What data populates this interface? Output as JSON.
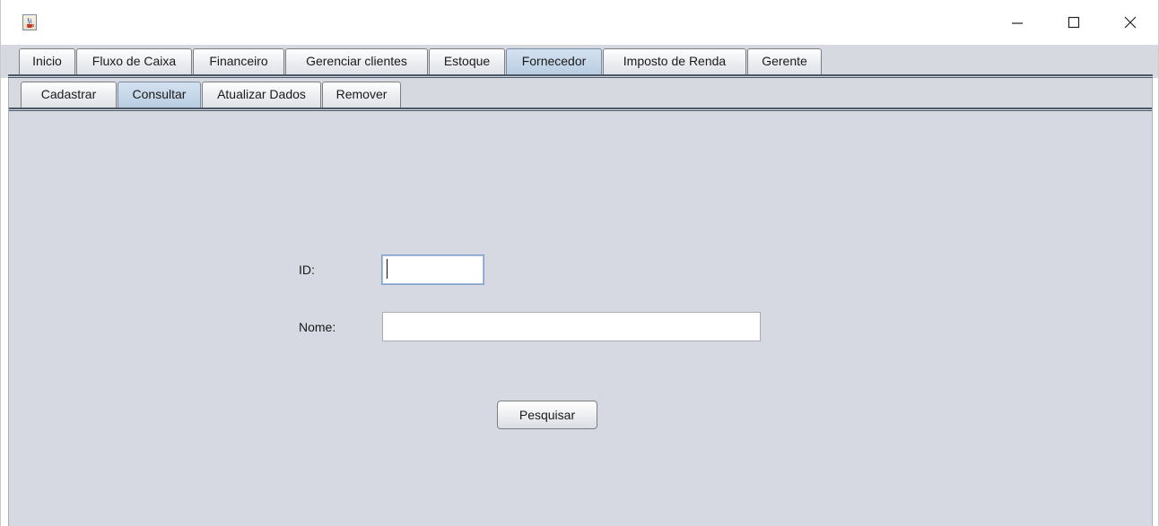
{
  "window": {
    "title": "",
    "icon": "java-cup-icon",
    "controls": {
      "minimize_icon": "minimize-icon",
      "maximize_icon": "maximize-icon",
      "close_icon": "close-icon"
    }
  },
  "main_tabs": {
    "items": [
      {
        "label": "Inicio"
      },
      {
        "label": "Fluxo de Caixa"
      },
      {
        "label": "Financeiro"
      },
      {
        "label": "Gerenciar clientes"
      },
      {
        "label": "Estoque"
      },
      {
        "label": "Fornecedor"
      },
      {
        "label": "Imposto de Renda"
      },
      {
        "label": "Gerente"
      }
    ],
    "selected": "Fornecedor"
  },
  "sub_tabs": {
    "items": [
      {
        "label": "Cadastrar"
      },
      {
        "label": "Consultar"
      },
      {
        "label": "Atualizar Dados"
      },
      {
        "label": "Remover"
      }
    ],
    "selected": "Consultar"
  },
  "form": {
    "id_label": "ID:",
    "id_value": "",
    "nome_label": "Nome:",
    "nome_value": "",
    "search_button": "Pesquisar"
  },
  "colors": {
    "selected_tab": "#b9cde2",
    "panel_background": "#d6d9e1",
    "tab_separator": "#4b5666"
  }
}
